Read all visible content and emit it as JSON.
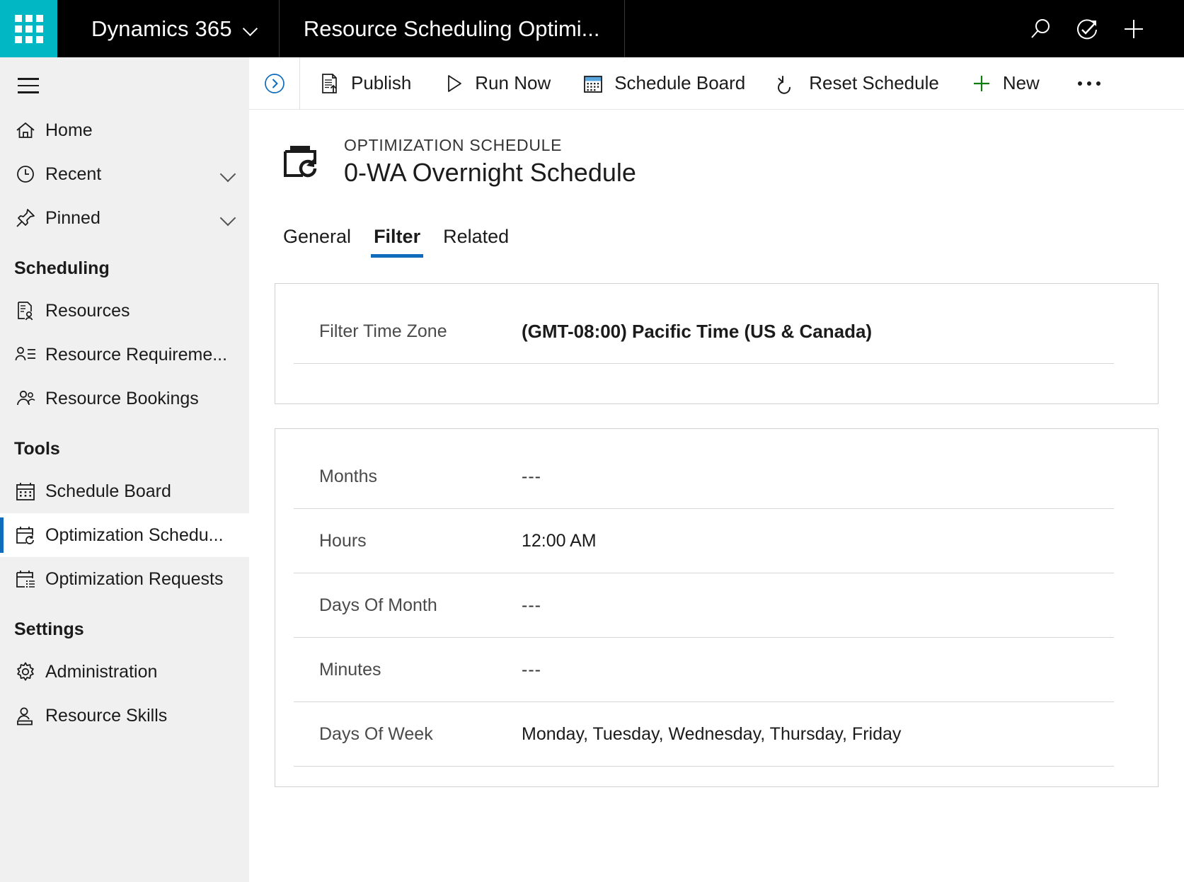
{
  "appbar": {
    "waffle_label": "app-launcher",
    "brand": "Dynamics 365",
    "app_title": "Resource Scheduling Optimi...",
    "actions": [
      {
        "name": "search-icon",
        "label": "Search"
      },
      {
        "name": "assistant-icon",
        "label": "Assistant"
      },
      {
        "name": "plus-icon",
        "label": "New"
      }
    ]
  },
  "sidebar": {
    "menu_label": "Site Map",
    "quick": [
      {
        "label": "Home",
        "icon": "home-icon",
        "chevron": false,
        "selected": false
      },
      {
        "label": "Recent",
        "icon": "clock-icon",
        "chevron": true,
        "selected": false
      },
      {
        "label": "Pinned",
        "icon": "pin-icon",
        "chevron": true,
        "selected": false
      }
    ],
    "groups": [
      {
        "title": "Scheduling",
        "items": [
          {
            "label": "Resources",
            "icon": "resource-icon",
            "selected": false
          },
          {
            "label": "Resource Requireme...",
            "icon": "requirements-icon",
            "selected": false
          },
          {
            "label": "Resource Bookings",
            "icon": "bookings-icon",
            "selected": false
          }
        ]
      },
      {
        "title": "Tools",
        "items": [
          {
            "label": "Schedule Board",
            "icon": "calendar-icon",
            "selected": false
          },
          {
            "label": "Optimization Schedu...",
            "icon": "calendar-refresh-icon",
            "selected": true
          },
          {
            "label": "Optimization Requests",
            "icon": "calendar-list-icon",
            "selected": false
          }
        ]
      },
      {
        "title": "Settings",
        "items": [
          {
            "label": "Administration",
            "icon": "gear-icon",
            "selected": false
          },
          {
            "label": "Resource Skills",
            "icon": "person-card-icon",
            "selected": false
          }
        ]
      }
    ]
  },
  "commandbar": {
    "back_label": "Expand",
    "buttons": [
      {
        "label": "Publish",
        "icon": "publish-icon"
      },
      {
        "label": "Run Now",
        "icon": "play-icon"
      },
      {
        "label": "Schedule Board",
        "icon": "calendar-icon"
      },
      {
        "label": "Reset Schedule",
        "icon": "undo-icon"
      },
      {
        "label": "New",
        "icon": "plus-icon"
      }
    ],
    "overflow_label": "More commands"
  },
  "record": {
    "entity_icon": "optimization-schedule-icon",
    "kicker": "OPTIMIZATION SCHEDULE",
    "title": "0-WA Overnight Schedule"
  },
  "tabs": [
    {
      "label": "General",
      "active": false
    },
    {
      "label": "Filter",
      "active": true
    },
    {
      "label": "Related",
      "active": false
    }
  ],
  "cards": [
    {
      "name": "timezone-card",
      "fields": [
        {
          "label": "Filter Time Zone",
          "value": "(GMT-08:00) Pacific Time (US & Canada)",
          "bold": true,
          "empty": false
        }
      ]
    },
    {
      "name": "recurrence-card",
      "fields": [
        {
          "label": "Months",
          "value": "---",
          "bold": false,
          "empty": true
        },
        {
          "label": "Hours",
          "value": "12:00 AM",
          "bold": false,
          "empty": false
        },
        {
          "label": "Days Of Month",
          "value": "---",
          "bold": false,
          "empty": true
        },
        {
          "label": "Minutes",
          "value": "---",
          "bold": false,
          "empty": true
        },
        {
          "label": "Days Of Week",
          "value": "Monday, Tuesday, Wednesday, Thursday, Friday",
          "bold": false,
          "empty": false
        }
      ]
    }
  ],
  "colors": {
    "brand_teal": "#00b7c3",
    "appbar_black": "#000000",
    "accent_blue": "#0f6cbd",
    "new_green": "#107c10",
    "sidebar_gray": "#f0f0f0",
    "border_gray": "#d1d1d1"
  }
}
